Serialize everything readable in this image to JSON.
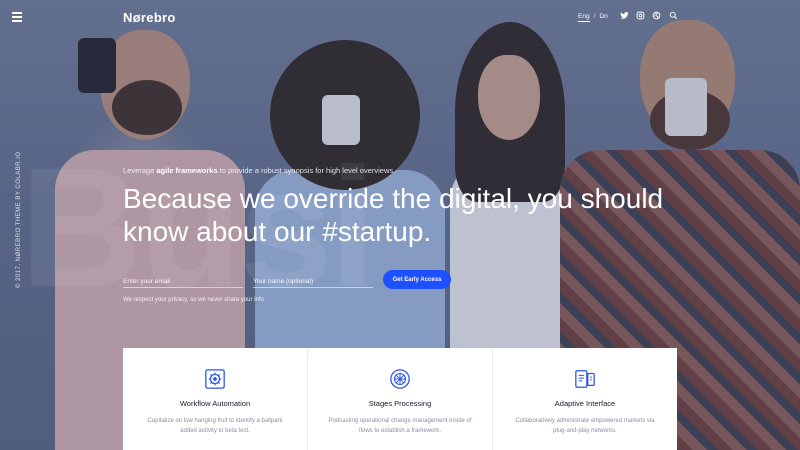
{
  "header": {
    "logo": "Nørebro",
    "languages": [
      "Eng",
      "Dn"
    ],
    "social_icons": [
      "twitter-icon",
      "instagram-icon",
      "dribbble-icon"
    ],
    "search_icon": "search-icon",
    "menu_icon": "hamburger-menu-icon"
  },
  "side_copyright": "© 2017, NØREBRO THEME BY COLABR.IO",
  "watermark_text": "Busi",
  "hero": {
    "tagline_prefix": "Leverage ",
    "tagline_bold": "agile frameworks",
    "tagline_suffix": " to provide a robust synopsis for high level overviews.",
    "headline": "Because we override the digital, you should know about our #startup."
  },
  "form": {
    "email_placeholder": "Enter your email",
    "name_placeholder": "Your name (optional)",
    "button_label": "Get Early Access",
    "privacy_note": "We respect your privacy, so we never share your info"
  },
  "features": [
    {
      "icon": "workflow-gear-icon",
      "title": "Workflow Automation",
      "text": "Capitalize on low hanging fruit to identify a ballpark added activity to beta test."
    },
    {
      "icon": "stages-compass-icon",
      "title": "Stages Processing",
      "text": "Podcasting operational change management inside of flows to establish a framework."
    },
    {
      "icon": "adaptive-devices-icon",
      "title": "Adaptive Interface",
      "text": "Collaboratively administrate empowered markets via plug-and-play networks."
    }
  ],
  "colors": {
    "accent": "#1f50ff",
    "icon_blue": "#2b55e6",
    "overlay": "#5b6a86"
  }
}
